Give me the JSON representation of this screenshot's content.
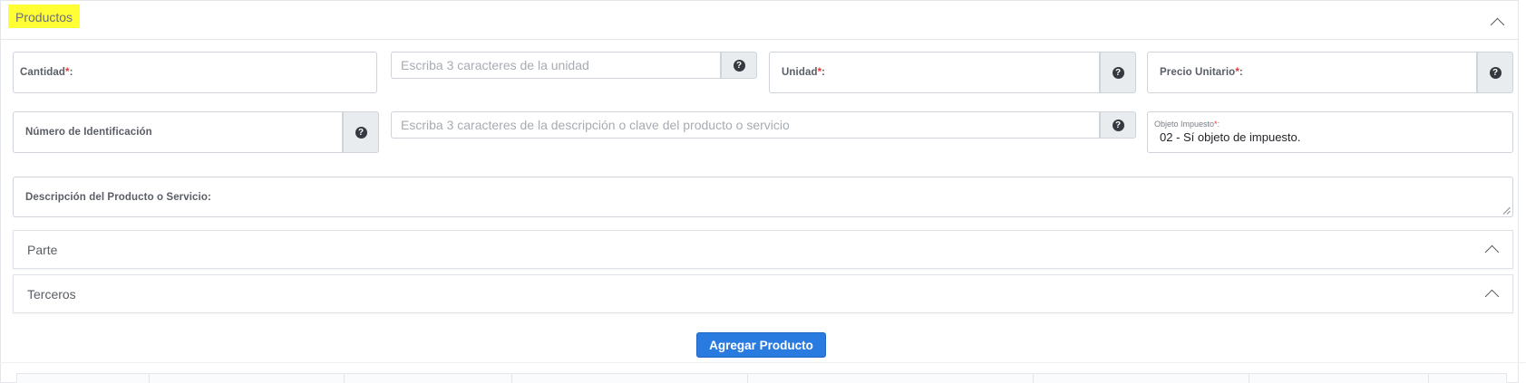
{
  "section": {
    "title": "Productos",
    "collapse_icon": "chevron-up-icon"
  },
  "fields": {
    "cantidad": {
      "label": "Cantidad",
      "required_mark": "*",
      "suffix": ":"
    },
    "unidad_search": {
      "placeholder": "Escriba 3 caracteres de la unidad",
      "help_icon": "question-circle-icon"
    },
    "unidad": {
      "label": "Unidad",
      "required_mark": "*",
      "suffix": ":",
      "help_icon": "question-circle-icon"
    },
    "precio_unitario": {
      "label": "Precio Unitario",
      "required_mark": "*",
      "suffix": ":",
      "help_icon": "question-circle-icon"
    },
    "numero_identificacion": {
      "label": "Número de Identificación",
      "help_icon": "question-circle-icon"
    },
    "descripcion_search": {
      "placeholder": "Escriba 3 caracteres de la descripción o clave del producto o servicio",
      "help_icon": "question-circle-icon"
    },
    "objeto_impuesto": {
      "label": "Objeto Impuesto",
      "required_mark": "*",
      "suffix": ":",
      "value": "02 - Sí objeto de impuesto."
    },
    "descripcion": {
      "label": "Descripción del Producto o Servicio:"
    }
  },
  "subsections": {
    "parte": {
      "title": "Parte",
      "icon": "chevron-up-icon"
    },
    "terceros": {
      "title": "Terceros",
      "icon": "chevron-up-icon"
    }
  },
  "actions": {
    "add_product": "Agregar Producto"
  },
  "icons": {
    "help_glyph": "?"
  },
  "colors": {
    "highlight": "#ffff33",
    "primary": "#2a7be0",
    "required": "#e53935"
  }
}
